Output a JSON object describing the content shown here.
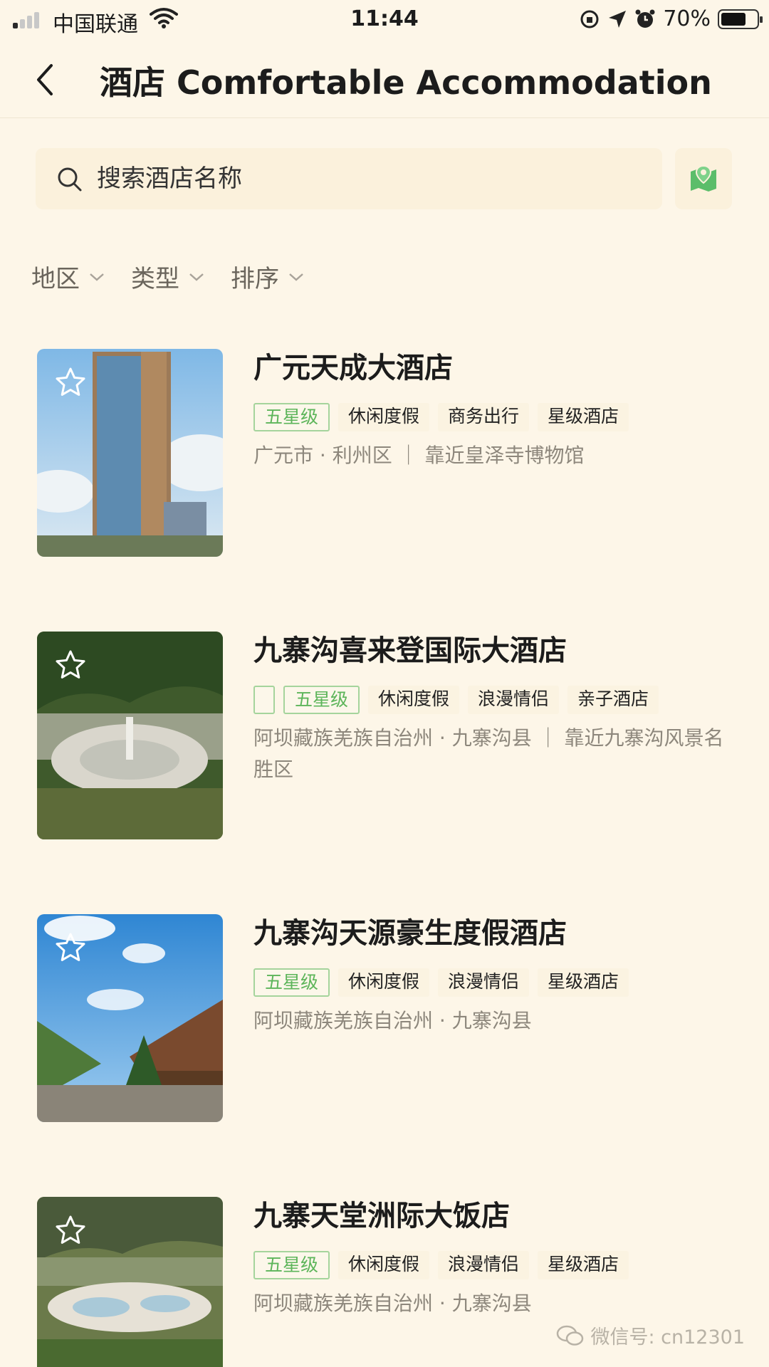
{
  "status_bar": {
    "carrier": "中国联通",
    "time": "11:44",
    "battery_percent": "70%",
    "battery_level": 0.7,
    "signal_bars_active": 1
  },
  "nav": {
    "title": "酒店 Comfortable Accommodation",
    "back_icon": "chevron-left-icon"
  },
  "search": {
    "placeholder": "搜索酒店名称",
    "map_icon": "map-pin-icon"
  },
  "filters": [
    {
      "label": "地区"
    },
    {
      "label": "类型"
    },
    {
      "label": "排序"
    }
  ],
  "colors": {
    "background": "#fdf6e8",
    "star_tag_green": "#5db55a",
    "map_green": "#5bbd6a"
  },
  "hotels": [
    {
      "name": "广元天成大酒店",
      "star_tag": "五星级",
      "tags": [
        "休闲度假",
        "商务出行",
        "星级酒店"
      ],
      "location": "广元市 · 利州区  ｜  靠近皇泽寺博物馆"
    },
    {
      "name": "九寨沟喜来登国际大酒店",
      "star_tag": "五星级",
      "tags": [
        "休闲度假",
        "浪漫情侣",
        "亲子酒店"
      ],
      "location": "阿坝藏族羌族自治州 · 九寨沟县  ｜  靠近九寨沟风景名胜区"
    },
    {
      "name": "九寨沟天源豪生度假酒店",
      "star_tag": "五星级",
      "tags": [
        "休闲度假",
        "浪漫情侣",
        "星级酒店"
      ],
      "location": "阿坝藏族羌族自治州 · 九寨沟县"
    },
    {
      "name": "九寨天堂洲际大饭店",
      "star_tag": "五星级",
      "tags": [
        "休闲度假",
        "浪漫情侣",
        "星级酒店"
      ],
      "location": "阿坝藏族羌族自治州 · 九寨沟县"
    }
  ],
  "watermark": "微信号: cn12301"
}
